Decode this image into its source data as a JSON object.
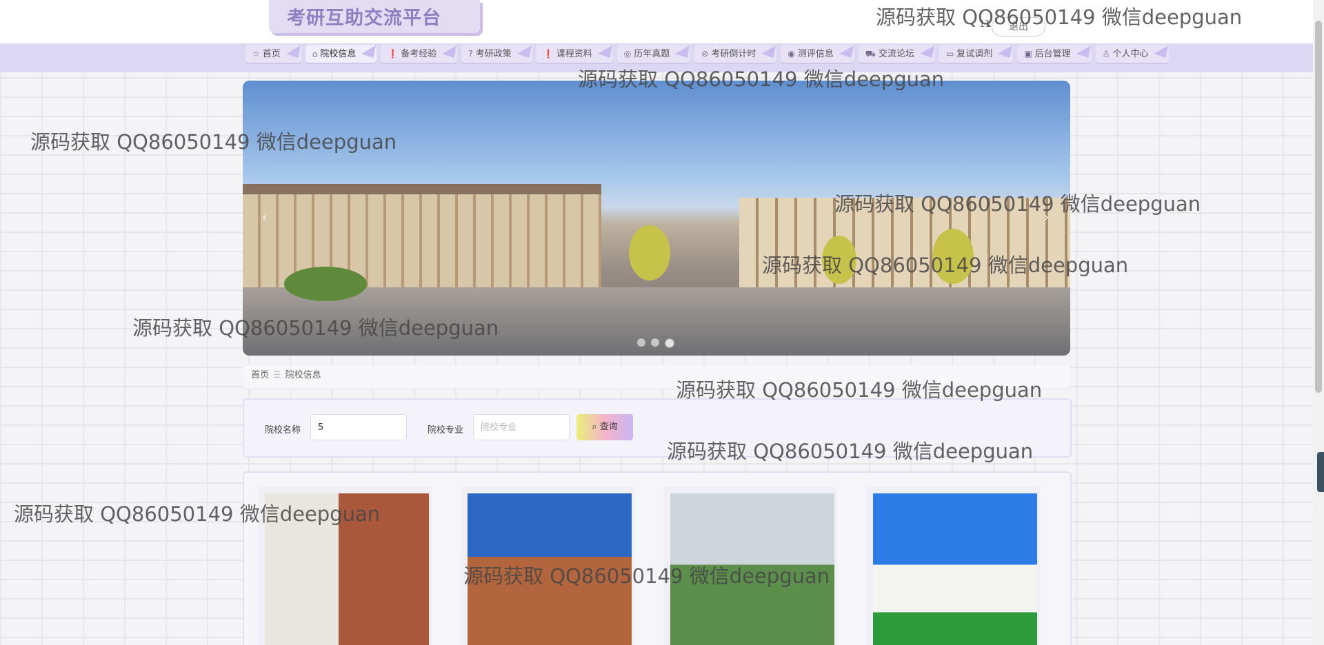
{
  "app": {
    "title": "考研互助交流平台"
  },
  "header": {
    "user_num": "11",
    "logout_label": "退出"
  },
  "nav": {
    "items": [
      {
        "icon": "☆",
        "label": "首页"
      },
      {
        "icon": "⌂",
        "label": "院校信息"
      },
      {
        "icon": "❗",
        "label": "备考经验"
      },
      {
        "icon": "?",
        "label": "考研政策"
      },
      {
        "icon": "❗",
        "label": "课程资料"
      },
      {
        "icon": "◎",
        "label": "历年真题"
      },
      {
        "icon": "⊘",
        "label": "考研倒计时"
      },
      {
        "icon": "◉",
        "label": "测评信息"
      },
      {
        "icon": "⛟",
        "label": "交流论坛"
      },
      {
        "icon": "▭",
        "label": "复试调剂"
      },
      {
        "icon": "▣",
        "label": "后台管理"
      },
      {
        "icon": "♙",
        "label": "个人中心"
      }
    ],
    "active_index": 1
  },
  "carousel": {
    "prev": "‹",
    "next": "›",
    "dot_count": 3,
    "active_dot": 2
  },
  "breadcrumb": {
    "home": "首页",
    "separator": "☰",
    "current": "院校信息"
  },
  "search": {
    "name_label": "院校名称",
    "name_value": "5",
    "major_label": "院校专业",
    "major_placeholder": "院校专业",
    "query_label": "查询",
    "query_icon": "search-icon"
  },
  "watermark_text": "源码获取 QQ86050149 微信deepguan",
  "colors": {
    "nav_bg": "#dcd8f4",
    "logo": "#8e7fc1",
    "accent": "#c9bdf0"
  }
}
